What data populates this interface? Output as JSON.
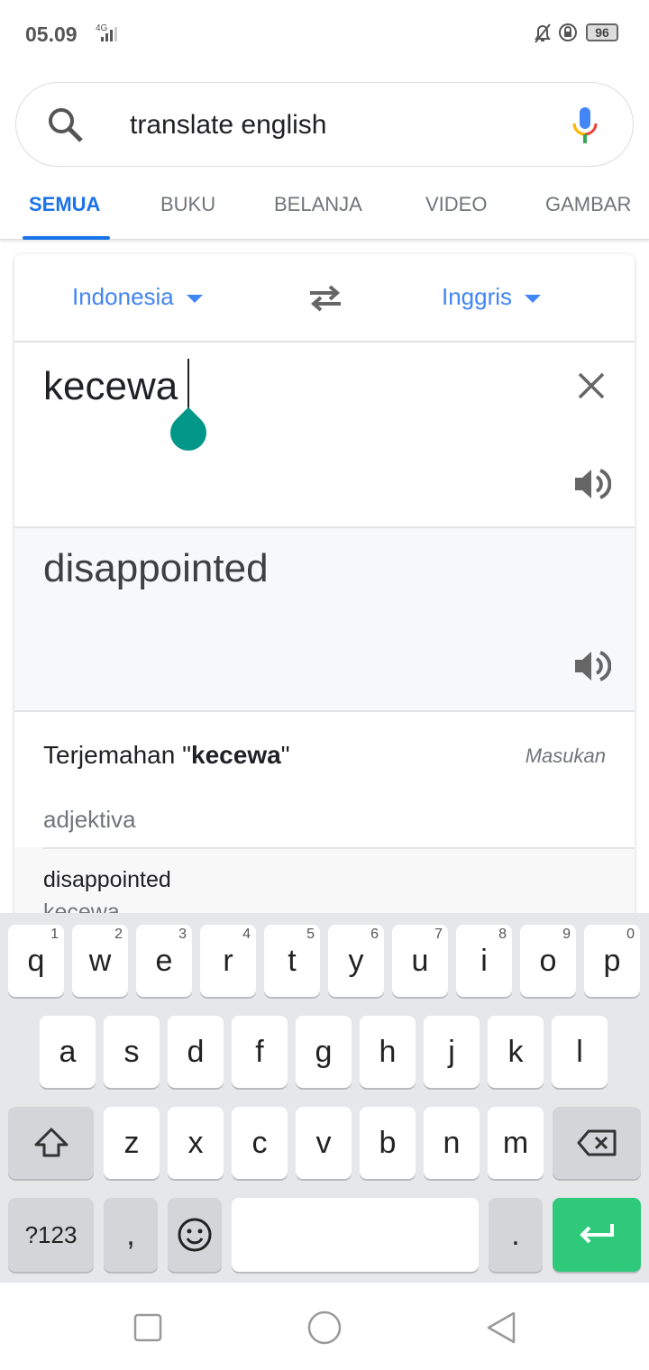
{
  "status": {
    "time": "05.09",
    "network": "4G",
    "battery": "96"
  },
  "search": {
    "query": "translate english"
  },
  "tabs": [
    {
      "label": "SEMUA",
      "active": true
    },
    {
      "label": "BUKU"
    },
    {
      "label": "BELANJA"
    },
    {
      "label": "VIDEO"
    },
    {
      "label": "GAMBAR"
    }
  ],
  "translate": {
    "source_lang": "Indonesia",
    "target_lang": "Inggris",
    "source_text": "kecewa",
    "target_text": "disappointed"
  },
  "dictionary": {
    "title_prefix": "Terjemahan \"",
    "title_word": "kecewa",
    "title_suffix": "\"",
    "feedback": "Masukan",
    "part_of_speech": "adjektiva",
    "entries": [
      {
        "word": "disappointed",
        "synonyms": "kecewa"
      }
    ]
  },
  "keyboard": {
    "row1": [
      [
        "q",
        "1"
      ],
      [
        "w",
        "2"
      ],
      [
        "e",
        "3"
      ],
      [
        "r",
        "4"
      ],
      [
        "t",
        "5"
      ],
      [
        "y",
        "6"
      ],
      [
        "u",
        "7"
      ],
      [
        "i",
        "8"
      ],
      [
        "o",
        "9"
      ],
      [
        "p",
        "0"
      ]
    ],
    "row2": [
      "a",
      "s",
      "d",
      "f",
      "g",
      "h",
      "j",
      "k",
      "l"
    ],
    "row3": [
      "z",
      "x",
      "c",
      "v",
      "b",
      "n",
      "m"
    ],
    "symbols": "?123",
    "comma": ",",
    "period": "."
  },
  "colors": {
    "accent": "#1a73e8",
    "enter": "#2fc97c",
    "handle": "#009688"
  }
}
